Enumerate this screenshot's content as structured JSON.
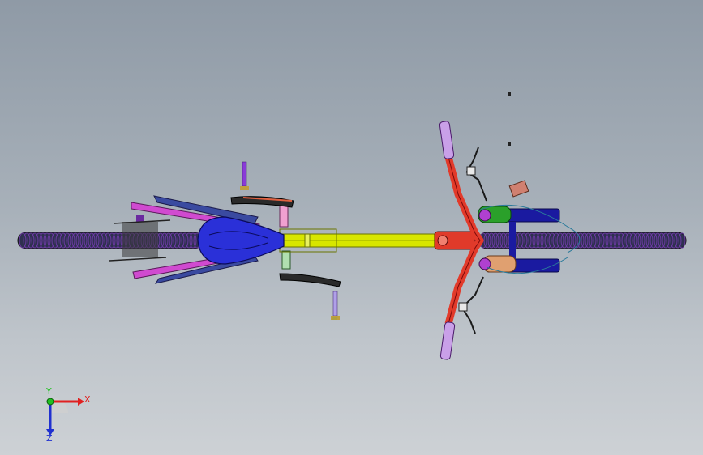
{
  "viewport": {
    "background_top": "#8f9aa6",
    "background_bottom": "#cdd1d5"
  },
  "model": {
    "colors": {
      "tire": "#2a2a4a",
      "tire_alt": "#4a2a6a",
      "top_tube": "#d8e600",
      "top_tube_edge": "#7a8400",
      "handlebar": "#e23a2a",
      "grip": "#c9a0e8",
      "saddle": "#2a2ad6",
      "seat_stay": "#b83ab8",
      "crank_arm": "#1a1a1a",
      "fork": "#1a1aa0",
      "hub_green": "#2aa02a",
      "hub_orange": "#e0a070",
      "pedal_purple": "#8a3ad8",
      "fender_blue": "#3a4aa0",
      "brake_lever": "#e8e8e8"
    }
  },
  "triad": {
    "x_label": "X",
    "y_label": "Y",
    "z_label": "Z",
    "x_color": "#e02020",
    "y_color": "#20c020",
    "z_color": "#2030d0"
  }
}
